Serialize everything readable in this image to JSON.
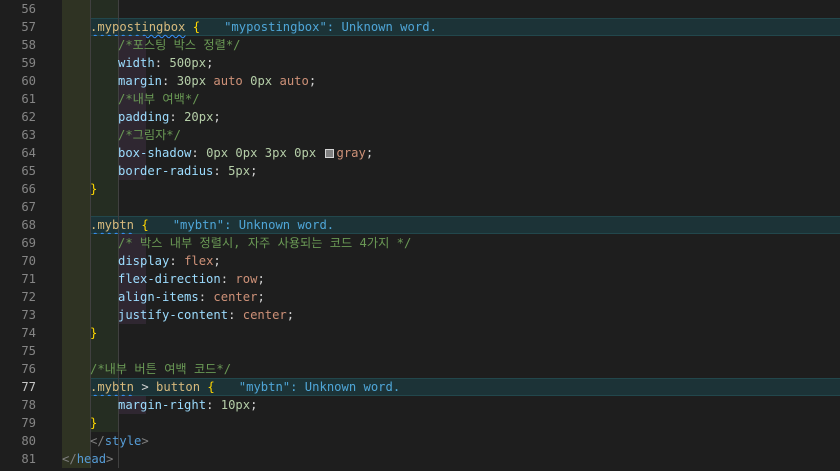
{
  "editor": {
    "lines": [
      {
        "number": "56",
        "indent": 0,
        "band": false,
        "tokens": []
      },
      {
        "number": "57",
        "indent": 1,
        "band": true,
        "tokens": [
          {
            "text": ".mypostingbox",
            "cls": "sel sqg"
          },
          {
            "text": " ",
            "cls": "punc"
          },
          {
            "text": "{",
            "cls": "brace"
          },
          {
            "text": "\"mypostingbox\": Unknown word.",
            "cls": "diag"
          }
        ]
      },
      {
        "number": "58",
        "indent": 2,
        "band": false,
        "tokens": [
          {
            "text": "/*포스팅 박스 정렬*/",
            "cls": "comment"
          }
        ]
      },
      {
        "number": "59",
        "indent": 2,
        "band": false,
        "tokens": [
          {
            "text": "width",
            "cls": "prop"
          },
          {
            "text": ": ",
            "cls": "punc"
          },
          {
            "text": "500px",
            "cls": "num"
          },
          {
            "text": ";",
            "cls": "punc"
          }
        ]
      },
      {
        "number": "60",
        "indent": 2,
        "band": false,
        "tokens": [
          {
            "text": "margin",
            "cls": "prop"
          },
          {
            "text": ": ",
            "cls": "punc"
          },
          {
            "text": "30px",
            "cls": "num"
          },
          {
            "text": " ",
            "cls": "punc"
          },
          {
            "text": "auto",
            "cls": "kw"
          },
          {
            "text": " ",
            "cls": "punc"
          },
          {
            "text": "0px",
            "cls": "num"
          },
          {
            "text": " ",
            "cls": "punc"
          },
          {
            "text": "auto",
            "cls": "kw"
          },
          {
            "text": ";",
            "cls": "punc"
          }
        ]
      },
      {
        "number": "61",
        "indent": 2,
        "band": false,
        "tokens": [
          {
            "text": "/*내부 여백*/",
            "cls": "comment"
          }
        ]
      },
      {
        "number": "62",
        "indent": 2,
        "band": false,
        "tokens": [
          {
            "text": "padding",
            "cls": "prop"
          },
          {
            "text": ": ",
            "cls": "punc"
          },
          {
            "text": "20px",
            "cls": "num"
          },
          {
            "text": ";",
            "cls": "punc"
          }
        ]
      },
      {
        "number": "63",
        "indent": 2,
        "band": false,
        "tokens": [
          {
            "text": "/*그림자*/",
            "cls": "comment"
          }
        ]
      },
      {
        "number": "64",
        "indent": 2,
        "band": false,
        "tokens": [
          {
            "text": "box-shadow",
            "cls": "prop"
          },
          {
            "text": ": ",
            "cls": "punc"
          },
          {
            "text": "0px",
            "cls": "num"
          },
          {
            "text": " ",
            "cls": "punc"
          },
          {
            "text": "0px",
            "cls": "num"
          },
          {
            "text": " ",
            "cls": "punc"
          },
          {
            "text": "3px",
            "cls": "num"
          },
          {
            "text": " ",
            "cls": "punc"
          },
          {
            "text": "0px",
            "cls": "num"
          },
          {
            "text": " ",
            "cls": "punc"
          },
          {
            "swatch": true
          },
          {
            "text": "gray",
            "cls": "kw"
          },
          {
            "text": ";",
            "cls": "punc"
          }
        ]
      },
      {
        "number": "65",
        "indent": 2,
        "band": false,
        "tokens": [
          {
            "text": "border-radius",
            "cls": "prop"
          },
          {
            "text": ": ",
            "cls": "punc"
          },
          {
            "text": "5px",
            "cls": "num"
          },
          {
            "text": ";",
            "cls": "punc"
          }
        ]
      },
      {
        "number": "66",
        "indent": 1,
        "band": false,
        "tokens": [
          {
            "text": "}",
            "cls": "brace"
          }
        ]
      },
      {
        "number": "67",
        "indent": 0,
        "band": false,
        "tokens": []
      },
      {
        "number": "68",
        "indent": 1,
        "band": true,
        "tokens": [
          {
            "text": ".mybtn",
            "cls": "sel sqg"
          },
          {
            "text": " ",
            "cls": "punc"
          },
          {
            "text": "{",
            "cls": "brace"
          },
          {
            "text": "\"mybtn\": Unknown word.",
            "cls": "diag"
          }
        ]
      },
      {
        "number": "69",
        "indent": 2,
        "band": false,
        "tokens": [
          {
            "text": "/* 박스 내부 정렬시, 자주 사용되는 코드 4가지 */",
            "cls": "comment"
          }
        ]
      },
      {
        "number": "70",
        "indent": 2,
        "band": false,
        "tokens": [
          {
            "text": "display",
            "cls": "prop"
          },
          {
            "text": ": ",
            "cls": "punc"
          },
          {
            "text": "flex",
            "cls": "kw"
          },
          {
            "text": ";",
            "cls": "punc"
          }
        ]
      },
      {
        "number": "71",
        "indent": 2,
        "band": false,
        "tokens": [
          {
            "text": "flex-direction",
            "cls": "prop"
          },
          {
            "text": ": ",
            "cls": "punc"
          },
          {
            "text": "row",
            "cls": "kw"
          },
          {
            "text": ";",
            "cls": "punc"
          }
        ]
      },
      {
        "number": "72",
        "indent": 2,
        "band": false,
        "tokens": [
          {
            "text": "align-items",
            "cls": "prop"
          },
          {
            "text": ": ",
            "cls": "punc"
          },
          {
            "text": "center",
            "cls": "kw"
          },
          {
            "text": ";",
            "cls": "punc"
          }
        ]
      },
      {
        "number": "73",
        "indent": 2,
        "band": false,
        "tokens": [
          {
            "text": "justify-content",
            "cls": "prop"
          },
          {
            "text": ": ",
            "cls": "punc"
          },
          {
            "text": "center",
            "cls": "kw"
          },
          {
            "text": ";",
            "cls": "punc"
          }
        ]
      },
      {
        "number": "74",
        "indent": 1,
        "band": false,
        "tokens": [
          {
            "text": "}",
            "cls": "brace"
          }
        ]
      },
      {
        "number": "75",
        "indent": 0,
        "band": false,
        "tokens": []
      },
      {
        "number": "76",
        "indent": 1,
        "band": false,
        "tokens": [
          {
            "text": "/*내부 버튼 여백 코드*/",
            "cls": "comment"
          }
        ]
      },
      {
        "number": "77",
        "indent": 1,
        "band": true,
        "active": true,
        "tokens": [
          {
            "text": ".mybtn",
            "cls": "sel sqg"
          },
          {
            "text": " > ",
            "cls": "punc"
          },
          {
            "text": "button",
            "cls": "sel"
          },
          {
            "text": " ",
            "cls": "punc"
          },
          {
            "text": "{",
            "cls": "brace"
          },
          {
            "text": "\"mybtn\": Unknown word.",
            "cls": "diag"
          }
        ]
      },
      {
        "number": "78",
        "indent": 2,
        "band": false,
        "tokens": [
          {
            "text": "margin-right",
            "cls": "prop"
          },
          {
            "text": ": ",
            "cls": "punc"
          },
          {
            "text": "10px",
            "cls": "num"
          },
          {
            "text": ";",
            "cls": "punc"
          }
        ]
      },
      {
        "number": "79",
        "indent": 1,
        "band": false,
        "tokens": [
          {
            "text": "}",
            "cls": "brace"
          }
        ]
      },
      {
        "number": "80",
        "indent": 1,
        "outdent": true,
        "band": false,
        "tokens": [
          {
            "text": "</",
            "cls": "lt"
          },
          {
            "text": "style",
            "cls": "tag"
          },
          {
            "text": ">",
            "cls": "lt"
          }
        ]
      },
      {
        "number": "81",
        "indent": 0,
        "band": false,
        "tokens": [
          {
            "text": "</",
            "cls": "lt"
          },
          {
            "text": "head",
            "cls": "tag"
          },
          {
            "text": ">",
            "cls": "lt"
          }
        ]
      }
    ]
  }
}
